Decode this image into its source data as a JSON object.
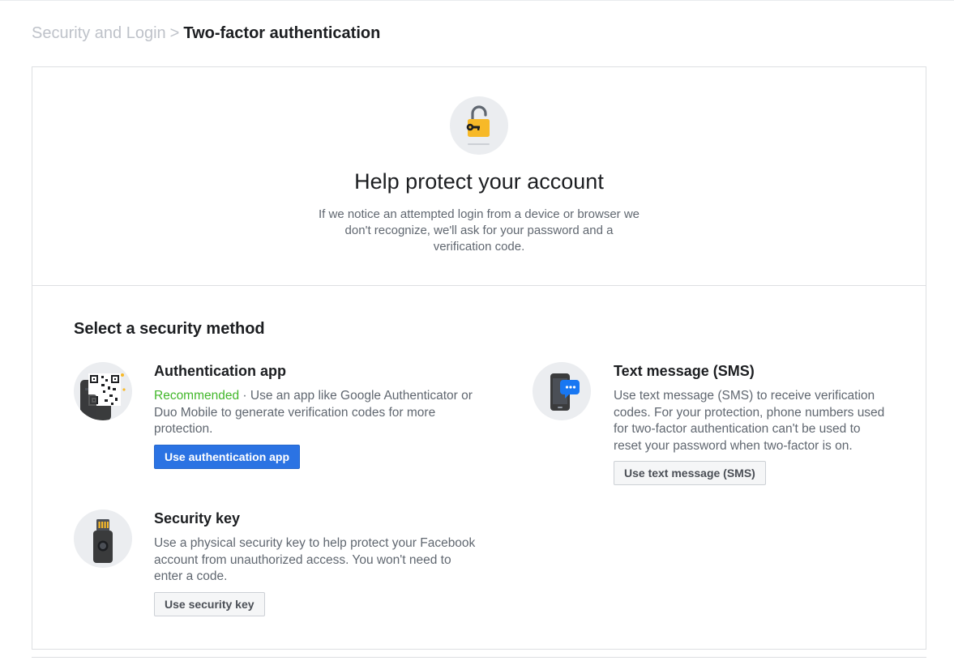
{
  "breadcrumb": {
    "parent": "Security and Login",
    "separator": ">",
    "current": "Two-factor authentication"
  },
  "hero": {
    "icon": "padlock-key-icon",
    "title": "Help protect your account",
    "description": "If we notice an attempted login from a device or browser we don't recognize, we'll ask for your password and a verification code."
  },
  "section": {
    "title": "Select a security method"
  },
  "methods": {
    "auth_app": {
      "icon": "qr-code-phone-icon",
      "title": "Authentication app",
      "recommended": "Recommended",
      "description": " · Use an app like Google Authenticator or Duo Mobile to generate verification codes for more protection.",
      "button": "Use authentication app"
    },
    "sms": {
      "icon": "phone-message-icon",
      "title": "Text message (SMS)",
      "description": "Use text message (SMS) to receive verification codes. For your protection, phone numbers used for two-factor authentication can't be used to reset your password when two-factor is on.",
      "button": "Use text message (SMS)"
    },
    "security_key": {
      "icon": "usb-security-key-icon",
      "title": "Security key",
      "description": "Use a physical security key to help protect your Facebook account from unauthorized access. You won't need to enter a code.",
      "button": "Use security key"
    }
  },
  "colors": {
    "primary_button": "#2b73e3",
    "recommended": "#42b72a",
    "icon_circle": "#ebedf0",
    "lock_yellow": "#f7b928"
  }
}
